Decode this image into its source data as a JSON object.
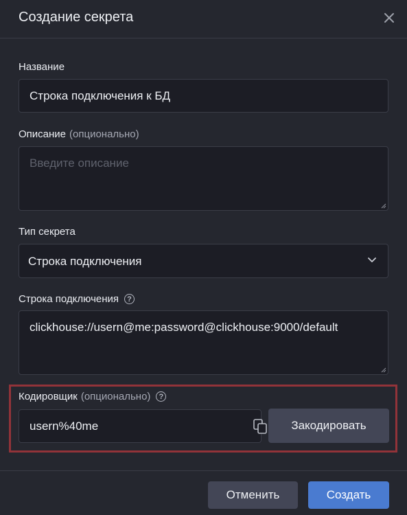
{
  "dialog": {
    "title": "Создание секрета",
    "close_icon": "close-icon"
  },
  "name_field": {
    "label": "Название",
    "value": "Строка подключения к БД"
  },
  "description_field": {
    "label": "Описание",
    "optional": "(опционально)",
    "placeholder": "Введите описание",
    "value": ""
  },
  "secret_type": {
    "label": "Тип секрета",
    "selected": "Строка подключения",
    "icon": "chevron-down-icon"
  },
  "connection_string": {
    "label": "Строка подключения",
    "help_glyph": "?",
    "value": "clickhouse://usern@me:password@clickhouse:9000/default"
  },
  "encoder": {
    "label": "Кодировщик",
    "optional": "(опционально)",
    "help_glyph": "?",
    "value": "usern%40me",
    "copy_icon": "copy-icon",
    "encode_button": "Закодировать",
    "highlight_color": "#923339"
  },
  "footer": {
    "cancel_button": "Отменить",
    "create_button": "Создать"
  },
  "colors": {
    "background": "#25272f",
    "input_background": "#1c1d25",
    "primary": "#4a7bd0",
    "secondary": "#434656"
  }
}
